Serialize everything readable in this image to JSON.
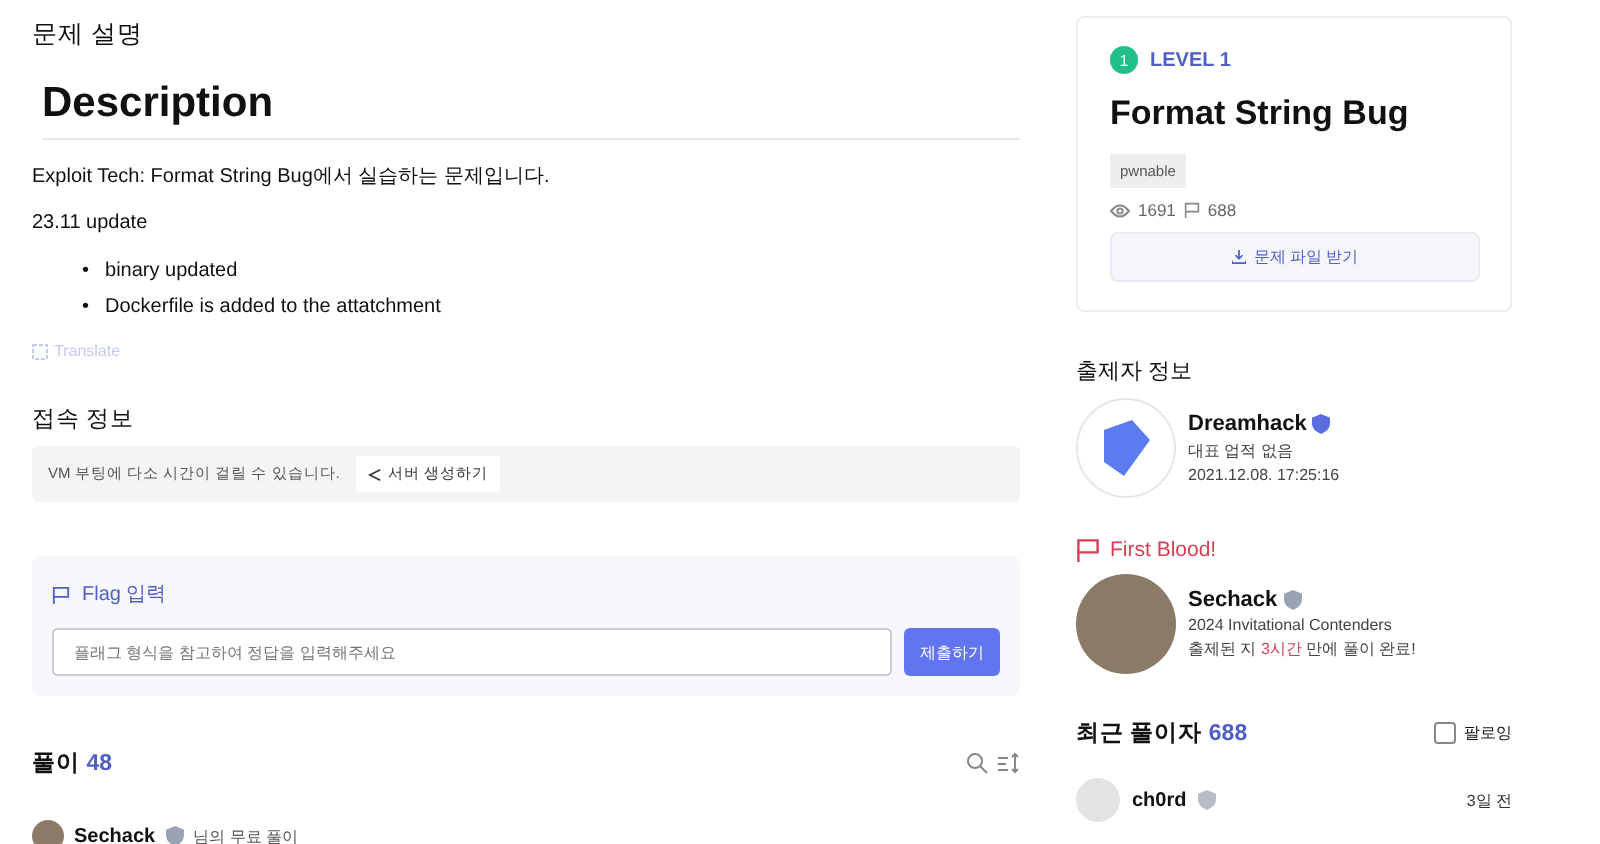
{
  "section_title": "문제 설명",
  "description": {
    "heading": "Description",
    "intro": "Exploit Tech: Format String Bug에서 실습하는 문제입니다.",
    "update": "23.11 update",
    "bullets": [
      {
        "marker": "•",
        "text": "binary updated"
      },
      {
        "marker": "•",
        "text": "Dockerfile is added to the attatchment"
      }
    ],
    "translate": "Translate"
  },
  "connection": {
    "title": "접속 정보",
    "note": "VM 부팅에 다소 시간이 걸릴 수 있습니다.",
    "button": "서버 생성하기"
  },
  "flag": {
    "title": "Flag 입력",
    "placeholder": "플래그 형식을 참고하여 정답을 입력해주세요",
    "submit": "제출하기"
  },
  "solutions": {
    "title": "풀이",
    "count": "48",
    "items": [
      {
        "user": "Sechack",
        "suffix": "님의 무료 풀이"
      }
    ]
  },
  "challenge": {
    "level_number": "1",
    "level": "LEVEL 1",
    "title": "Format String Bug",
    "tag": "pwnable",
    "views": "1691",
    "comments": "688",
    "download": "문제 파일 받기"
  },
  "author": {
    "title": "출제자 정보",
    "name": "Dreamhack",
    "achievement": "대표 업적 없음",
    "date": "2021.12.08. 17:25:16"
  },
  "first_blood": {
    "title": "First Blood!",
    "name": "Sechack",
    "achievement": "2024 Invitational Contenders",
    "time_prefix": "출제된 지 ",
    "time_highlight": "3시간",
    "time_suffix": " 만에 풀이 완료!"
  },
  "recent": {
    "title": "최근 풀이자",
    "count": "688",
    "following": {
      "label": "팔로잉",
      "checked": false
    },
    "items": [
      {
        "name": "ch0rd",
        "time": "3일 전"
      }
    ]
  }
}
